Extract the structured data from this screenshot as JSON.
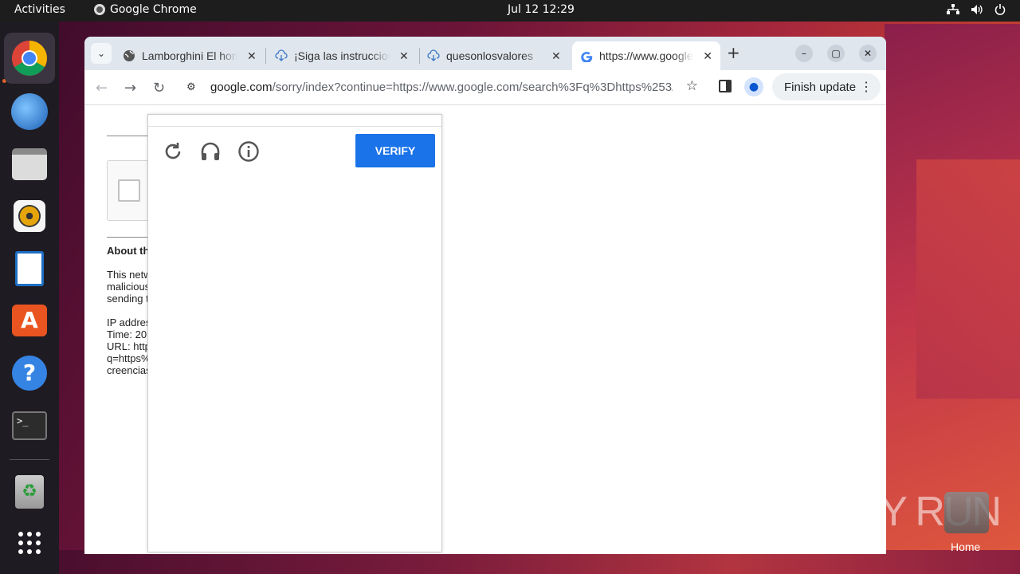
{
  "topbar": {
    "activities": "Activities",
    "app_name": "Google Chrome",
    "clock": "Jul 12  12:29"
  },
  "dock": {
    "items": [
      "chrome",
      "thunderbird",
      "files",
      "rhythmbox",
      "writer",
      "app-center",
      "help",
      "terminal",
      "trash",
      "show-apps"
    ]
  },
  "browser": {
    "tabs": [
      {
        "title": "Lamborghini El hombre",
        "icon": "globe-icon"
      },
      {
        "title": "¡Siga las instrucciones",
        "icon": "download-icon"
      },
      {
        "title": "quesonlosvalores",
        "icon": "download-icon"
      },
      {
        "title": "https://www.google.com",
        "icon": "google-icon"
      }
    ],
    "url_host": "google.com",
    "url_path": "/sorry/index?continue=https://www.google.com/search%3Fq%3Dhttps%253A...",
    "finish_update": "Finish update"
  },
  "page": {
    "about_heading": "About th",
    "para1": [
      "This netw",
      "malicious",
      "sending t"
    ],
    "para2": [
      "IP addres",
      "Time: 20",
      "URL: http",
      "q=https%",
      "creencias"
    ]
  },
  "challenge": {
    "verify_label": "VERIFY"
  },
  "desktop": {
    "home_label": "Home",
    "watermark": "ANY RUN"
  },
  "colors": {
    "verify_button": "#1a73e8",
    "topbar": "#1d1d1d",
    "dock": "#1f1b22"
  }
}
